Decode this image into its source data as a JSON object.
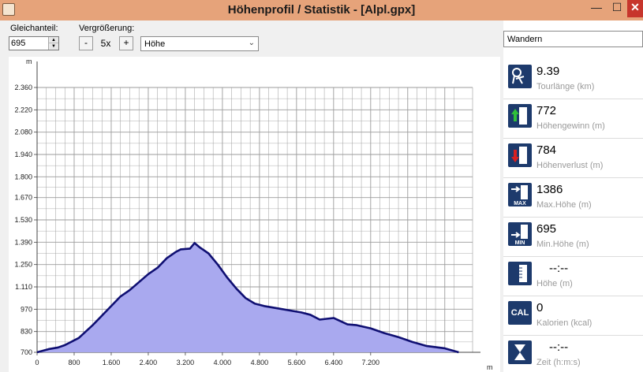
{
  "window": {
    "title": "Höhenprofil / Statistik - [Alpl.gpx]",
    "minimize": "—",
    "maximize": "☐",
    "close": "✕"
  },
  "toolbar": {
    "offset_label": "Gleichanteil:",
    "offset_value": "695",
    "zoom_label": "Vergrößerung:",
    "zoom_minus": "-",
    "zoom_value": "5x",
    "zoom_plus": "+",
    "profile_type": "Höhe"
  },
  "activity": "Wandern",
  "stats": [
    {
      "icon": "hiker-distance-icon",
      "value": "9.39",
      "label": "Tourlänge (km)"
    },
    {
      "icon": "elevation-gain-icon",
      "value": "772",
      "label": "Höhengewinn (m)"
    },
    {
      "icon": "elevation-loss-icon",
      "value": "784",
      "label": "Höhenverlust (m)"
    },
    {
      "icon": "max-elevation-icon",
      "value": "1386",
      "label": "Max.Höhe (m)"
    },
    {
      "icon": "min-elevation-icon",
      "value": "695",
      "label": "Min.Höhe (m)"
    },
    {
      "icon": "elevation-icon",
      "value": "--:--",
      "label": "Höhe (m)"
    },
    {
      "icon": "calories-icon",
      "value": "0",
      "label": "Kalorien (kcal)",
      "icon_text": "CAL"
    },
    {
      "icon": "hourglass-icon",
      "value": "--:--",
      "label": "Zeit (h:m:s)"
    }
  ],
  "colors": {
    "fill": "#a9a9ef",
    "line": "#0f0f72",
    "grid": "#9b9b9b",
    "icon_bg": "#1d3a6c",
    "titlebar": "#e6a37a"
  },
  "chart_data": {
    "type": "area",
    "title": "",
    "xlabel": "m",
    "ylabel": "m",
    "xlim": [
      0,
      9400
    ],
    "ylim": [
      700,
      2360
    ],
    "y_ticks": [
      "700",
      "830",
      "970",
      "1.110",
      "1.250",
      "1.390",
      "1.530",
      "1.670",
      "1.800",
      "1.940",
      "2.080",
      "2.220",
      "2.360"
    ],
    "y_tick_values": [
      700,
      830,
      970,
      1110,
      1250,
      1390,
      1530,
      1670,
      1800,
      1940,
      2080,
      2220,
      2360
    ],
    "x_ticks": [
      "0",
      "800",
      "1.600",
      "2.400",
      "3.200",
      "4.000",
      "4.800",
      "5.600",
      "6.400",
      "7.200"
    ],
    "x_tick_values": [
      0,
      800,
      1600,
      2400,
      3200,
      4000,
      4800,
      5600,
      6400,
      7200
    ],
    "grid": true,
    "series": [
      {
        "x": [
          0,
          250,
          450,
          600,
          900,
          1200,
          1500,
          1800,
          2000,
          2200,
          2400,
          2600,
          2800,
          3000,
          3100,
          3300,
          3400,
          3500,
          3700,
          3900,
          4100,
          4300,
          4500,
          4700,
          4900,
          5200,
          5500,
          5700,
          5900,
          6100,
          6400,
          6700,
          6900,
          7200,
          7500,
          7800,
          8100,
          8400,
          8800,
          9100
        ],
        "y": [
          700,
          720,
          730,
          745,
          790,
          870,
          960,
          1050,
          1090,
          1140,
          1190,
          1230,
          1290,
          1330,
          1345,
          1350,
          1385,
          1360,
          1320,
          1250,
          1170,
          1100,
          1040,
          1005,
          990,
          975,
          960,
          950,
          935,
          905,
          915,
          875,
          870,
          850,
          820,
          795,
          765,
          740,
          725,
          700
        ]
      }
    ]
  }
}
